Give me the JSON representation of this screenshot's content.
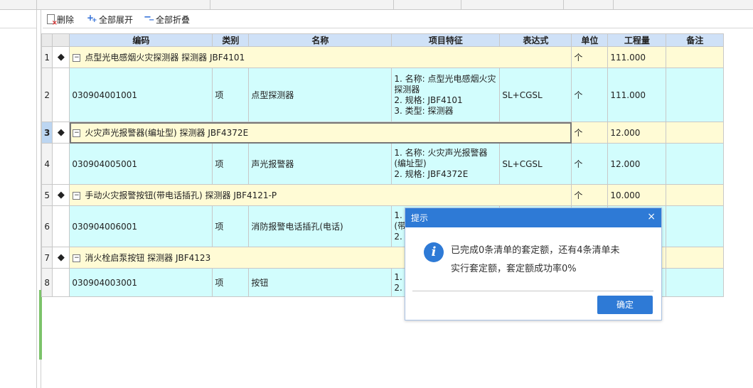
{
  "toolbar": {
    "delete_label": "删除",
    "expand_all_label": "全部展开",
    "collapse_all_label": "全部折叠"
  },
  "columns": {
    "code": "编码",
    "category": "类别",
    "name": "名称",
    "feature": "项目特征",
    "expression": "表达式",
    "unit": "单位",
    "quantity": "工程量",
    "remark": "备注"
  },
  "rows": [
    {
      "num": "1",
      "marker": "◆",
      "toggle": "−",
      "name": "点型光电感烟火灾探测器 探测器 JBF4101",
      "unit": "个",
      "quantity": "111.000"
    },
    {
      "num": "2",
      "code": "030904001001",
      "category": "项",
      "name": "点型探测器",
      "feature": [
        "1. 名称: 点型光电感烟火灾",
        "探测器",
        "2. 规格: JBF4101",
        "3. 类型: 探测器"
      ],
      "expression": "SL+CGSL",
      "unit": "个",
      "quantity": "111.000"
    },
    {
      "num": "3",
      "marker": "◆",
      "toggle": "−",
      "name": "火灾声光报警器(编址型) 探测器 JBF4372E",
      "unit": "个",
      "quantity": "12.000"
    },
    {
      "num": "4",
      "code": "030904005001",
      "category": "项",
      "name": "声光报警器",
      "feature": [
        "1. 名称: 火灾声光报警器",
        "(编址型)",
        "2. 规格: JBF4372E"
      ],
      "expression": "SL+CGSL",
      "unit": "个",
      "quantity": "12.000"
    },
    {
      "num": "5",
      "marker": "◆",
      "toggle": "−",
      "name": "手动火灾报警按钮(带电话插孔) 探测器 JBF4121-P",
      "unit": "个",
      "quantity": "10.000"
    },
    {
      "num": "6",
      "code": "030904006001",
      "category": "项",
      "name": "消防报警电话插孔(电话)",
      "feature": [
        "1.",
        "(带",
        "2."
      ]
    },
    {
      "num": "7",
      "marker": "◆",
      "toggle": "−",
      "name": "消火栓启泵按钮 探测器 JBF4123"
    },
    {
      "num": "8",
      "code": "030904003001",
      "category": "项",
      "name": "按钮",
      "feature": [
        "1.",
        "2."
      ]
    }
  ],
  "dialog": {
    "title": "提示",
    "close": "×",
    "icon": "i",
    "message_line1": "已完成0条清单的套定额，还有4条清单未",
    "message_line2": "实行套定额，套定额成功率0%",
    "ok_label": "确定"
  },
  "colors": {
    "header_blue": "#cfe1f7",
    "group_row": "#fffbd5",
    "item_row": "#d2fdfd",
    "dialog_blue": "#2e7ad6"
  }
}
